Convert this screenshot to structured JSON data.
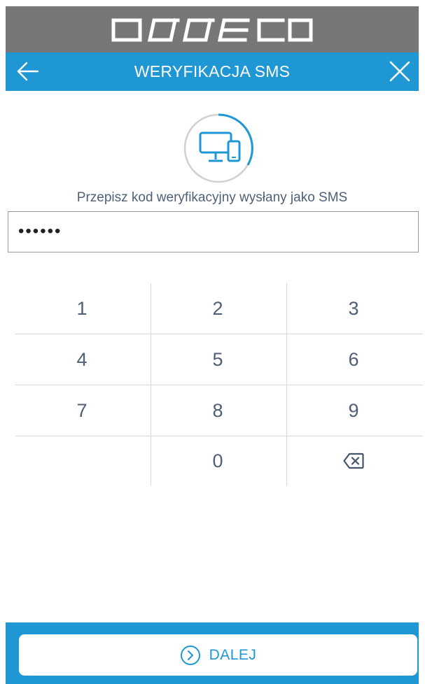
{
  "brand": {
    "logo_text": "asseco"
  },
  "header": {
    "title": "WERYFIKACJA SMS",
    "back_icon": "arrow-left-icon",
    "close_icon": "close-icon"
  },
  "illustration": {
    "icon": "monitor-phone-icon"
  },
  "instruction": "Przepisz kod weryfikacyjny wysłany jako SMS",
  "code_field": {
    "value": "••••••"
  },
  "keypad": {
    "keys": [
      "1",
      "2",
      "3",
      "4",
      "5",
      "6",
      "7",
      "8",
      "9",
      "",
      "0"
    ],
    "backspace_icon": "backspace-icon"
  },
  "footer": {
    "next_label": "DALEJ",
    "next_icon": "chevron-right-circle-icon"
  },
  "colors": {
    "brand_bar": "#777777",
    "accent": "#1f97d4",
    "text": "#4f5f78",
    "divider": "#d7d7d7"
  }
}
